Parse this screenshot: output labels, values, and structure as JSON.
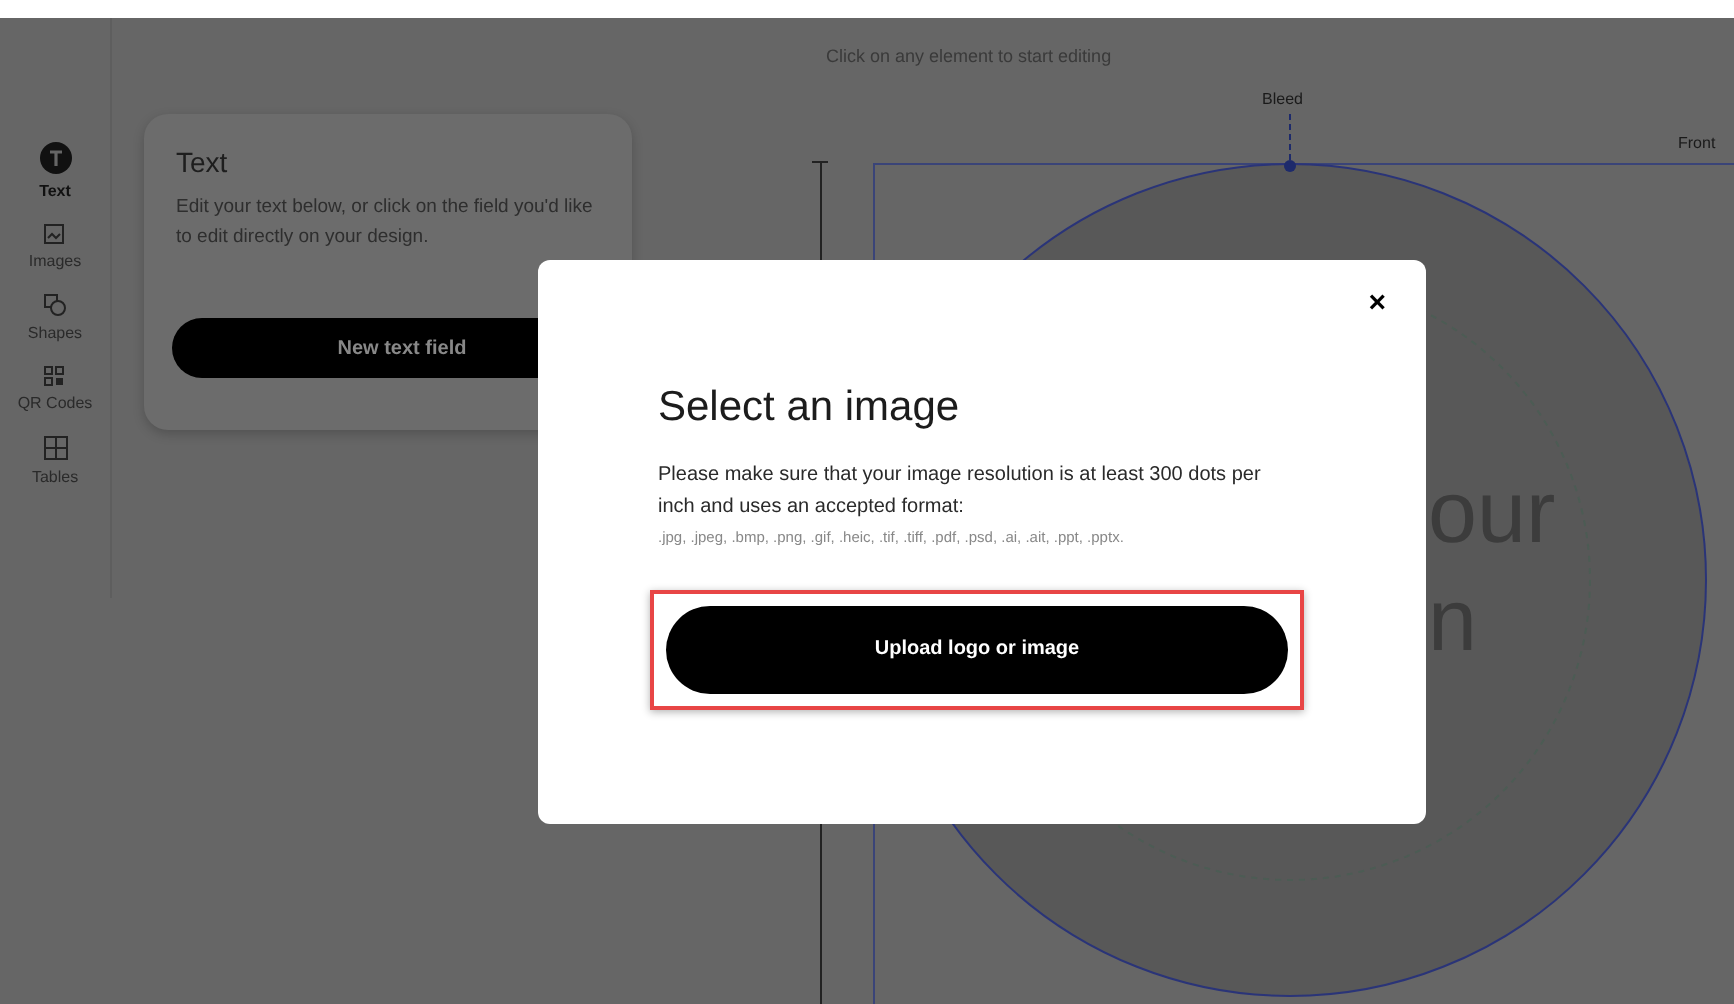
{
  "hint": "Click on any element to start editing",
  "sidebar": {
    "items": [
      {
        "label": "Text",
        "selected": true
      },
      {
        "label": "Images",
        "selected": false
      },
      {
        "label": "Shapes",
        "selected": false
      },
      {
        "label": "QR Codes",
        "selected": false
      },
      {
        "label": "Tables",
        "selected": false
      }
    ]
  },
  "panel": {
    "title": "Text",
    "description": "Edit your text below, or click on the field you'd like to edit directly on your design.",
    "button": "New text field"
  },
  "canvas": {
    "bleed_label": "Bleed",
    "side_label": "Front",
    "texts": [
      "our",
      "n"
    ]
  },
  "dialog": {
    "close": "×",
    "title": "Select an image",
    "description": "Please make sure that your image resolution is at least 300 dots per inch and uses an accepted format:",
    "formats": ".jpg, .jpeg, .bmp, .png, .gif, .heic, .tif, .tiff, .pdf, .psd, .ai, .ait, .ppt, .pptx.",
    "upload_button": "Upload logo or image",
    "upload_highlighted": true
  }
}
